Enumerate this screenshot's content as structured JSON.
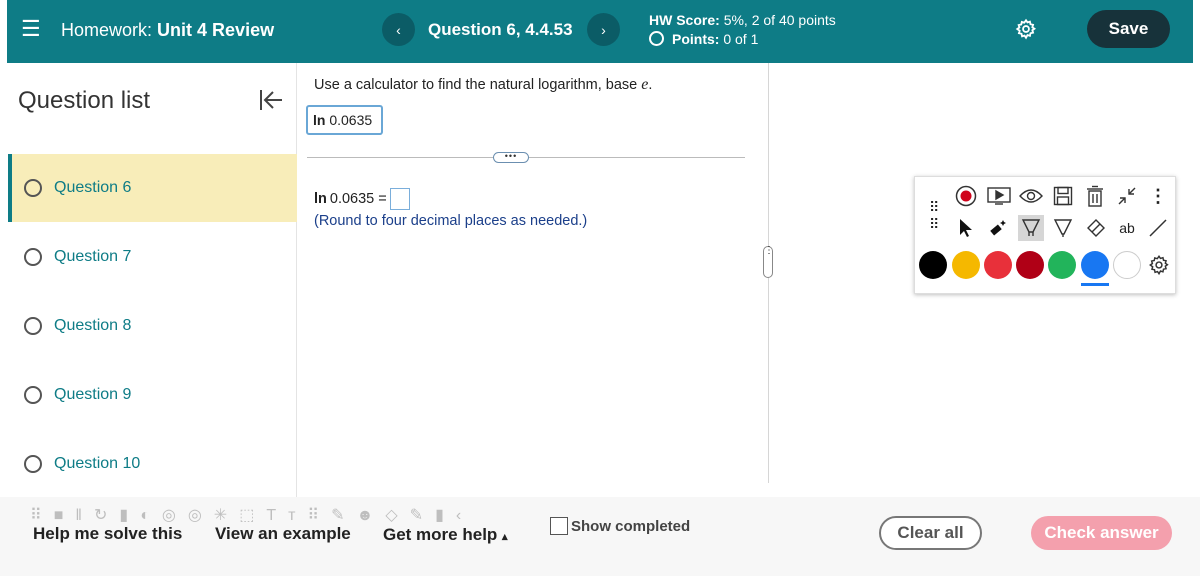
{
  "header": {
    "menu_icon": "hamburger-icon",
    "hw_prefix": "Homework:",
    "hw_name": "Unit 4 Review",
    "prev_label": "‹",
    "next_label": "›",
    "question_title": "Question 6, 4.4.53",
    "score_label": "HW Score:",
    "score_value": "5%, 2 of 40 points",
    "points_label": "Points:",
    "points_value": "0 of 1",
    "settings_icon": "gear-icon",
    "save_label": "Save",
    "accent_color": "#0e7c86"
  },
  "sidebar": {
    "title": "Question list",
    "collapse_icon": "collapse-left-icon",
    "items": [
      {
        "label": "Question 6",
        "active": true
      },
      {
        "label": "Question 7",
        "active": false
      },
      {
        "label": "Question 8",
        "active": false
      },
      {
        "label": "Question 9",
        "active": false
      },
      {
        "label": "Question 10",
        "active": false
      }
    ]
  },
  "question": {
    "instruction": "Use a calculator to find the natural logarithm, base",
    "base_symbol": "e",
    "period": ".",
    "ln_label": "ln",
    "expression_value": "0.0635",
    "answer_prefix_ln": "ln",
    "answer_prefix_value": "0.0635 =",
    "answer_value": "",
    "note": "(Round to four decimal places as needed.)"
  },
  "draw_toolbar": {
    "tools_row1": [
      "record-icon",
      "video-icon",
      "eye-icon",
      "save-disk-icon",
      "trash-icon",
      "collapse-arrows-icon",
      "more-vertical-icon"
    ],
    "tools_row2": [
      "pointer-icon",
      "laser-pointer-icon",
      "highlighter-icon",
      "pen-icon",
      "eraser-icon",
      "text-icon",
      "line-icon"
    ],
    "text_tool_label": "ab",
    "colors": [
      "#000000",
      "#f5b800",
      "#e8303a",
      "#b00016",
      "#22b45b",
      "#1877f2",
      "#ffffff"
    ],
    "selected_color": "#1877f2"
  },
  "footer": {
    "help_label": "Help me solve this",
    "example_label": "View an example",
    "more_help_label": "Get more help",
    "more_help_caret": "▴",
    "show_completed_label": "Show completed",
    "clear_label": "Clear all",
    "check_label": "Check answer"
  }
}
